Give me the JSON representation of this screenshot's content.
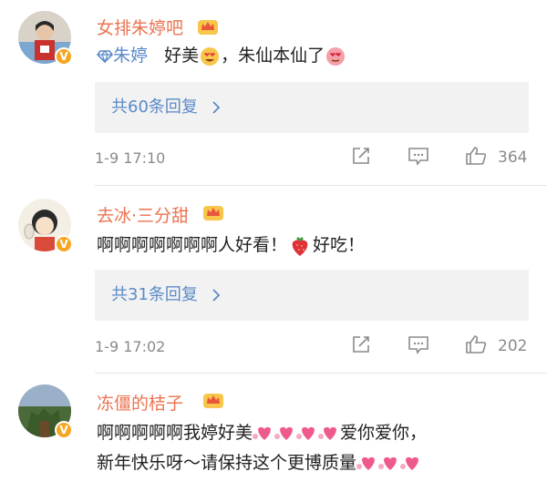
{
  "comments": [
    {
      "username": "女排朱婷吧",
      "mention": "朱婷",
      "text_a": "好美",
      "text_b": "，朱仙本仙了",
      "replies": "共60条回复",
      "time": "1-9 17:10",
      "likes": "364"
    },
    {
      "username": "去冰·三分甜",
      "text_a": "啊啊啊啊啊啊啊人好看！",
      "text_b": "好吃！",
      "replies": "共31条回复",
      "time": "1-9 17:02",
      "likes": "202"
    },
    {
      "username": "冻僵的桔子",
      "line1_a": "啊啊啊啊啊我婷好美",
      "line1_b": "爱你爱你，",
      "line2": "新年快乐呀～请保持这个更博质量"
    }
  ],
  "colors": {
    "username": "#eb7350",
    "link": "#5b8ac8",
    "meta": "#8a8a8a",
    "reply_bg": "#f2f2f2",
    "badge": "#f6a623"
  },
  "icons": [
    "crown-icon",
    "verified-badge-icon",
    "share-icon",
    "comment-icon",
    "like-icon",
    "heart-eyes-emoji",
    "strawberry-emoji",
    "hearts-emoji",
    "chevron-right-icon",
    "diamond-icon"
  ]
}
